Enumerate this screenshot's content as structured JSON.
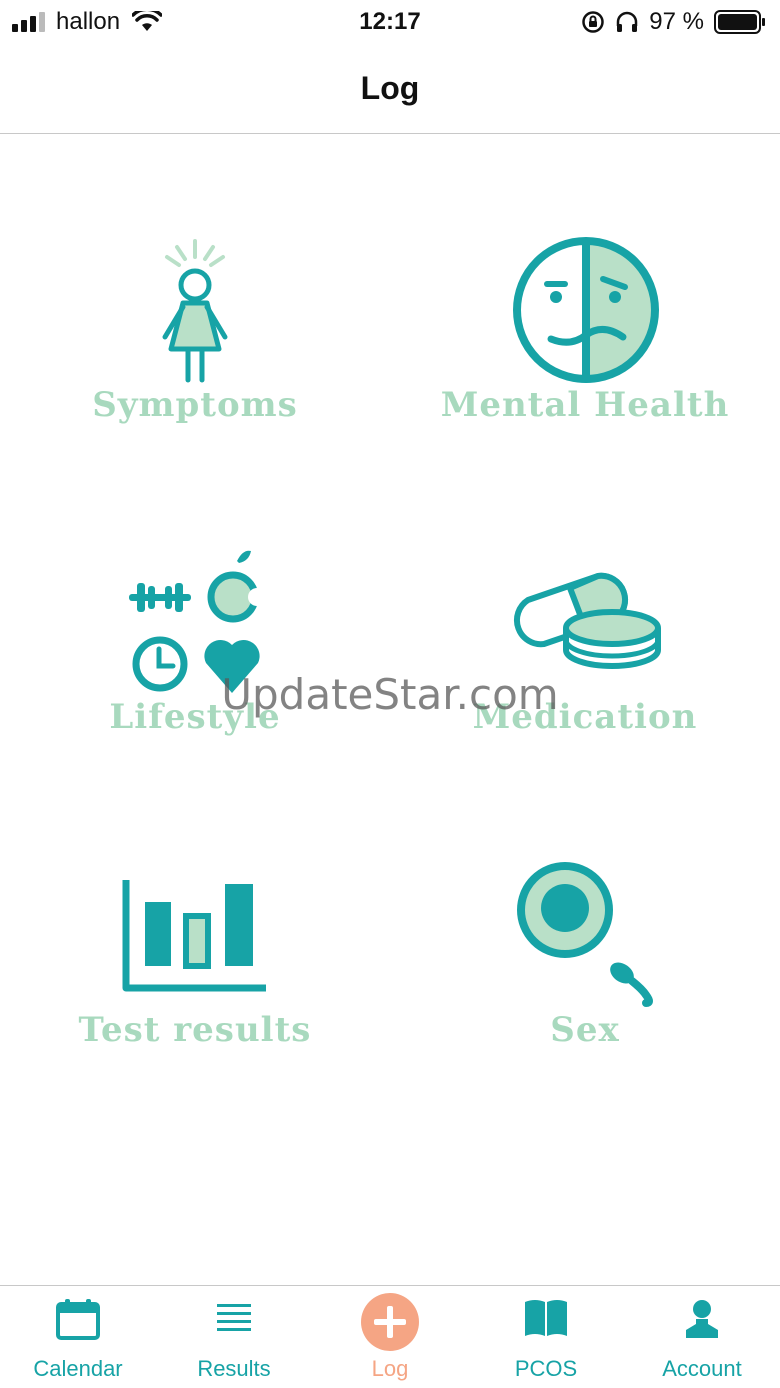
{
  "status_bar": {
    "carrier": "hallon",
    "time": "12:17",
    "battery": "97 %"
  },
  "navigation": {
    "title": "Log"
  },
  "tiles": [
    {
      "label": "Symptoms",
      "icon": "person-icon"
    },
    {
      "label": "Mental Health",
      "icon": "split-face-icon"
    },
    {
      "label": "Lifestyle",
      "icon": "lifestyle-icons"
    },
    {
      "label": "Medication",
      "icon": "pill-icon"
    },
    {
      "label": "Test results",
      "icon": "bar-chart-icon"
    },
    {
      "label": "Sex",
      "icon": "egg-sperm-icon"
    }
  ],
  "watermark": "UpdateStar.com",
  "tab_bar": {
    "items": [
      {
        "label": "Calendar",
        "icon": "calendar-icon"
      },
      {
        "label": "Results",
        "icon": "list-icon"
      },
      {
        "label": "Log",
        "icon": "plus-circle-icon",
        "active": true
      },
      {
        "label": "PCOS",
        "icon": "book-icon"
      },
      {
        "label": "Account",
        "icon": "person-icon"
      }
    ]
  },
  "colors": {
    "teal": "#17a3a6",
    "mint": "#b9e0c8",
    "label": "#a8d9be",
    "accent": "#f5a584"
  }
}
